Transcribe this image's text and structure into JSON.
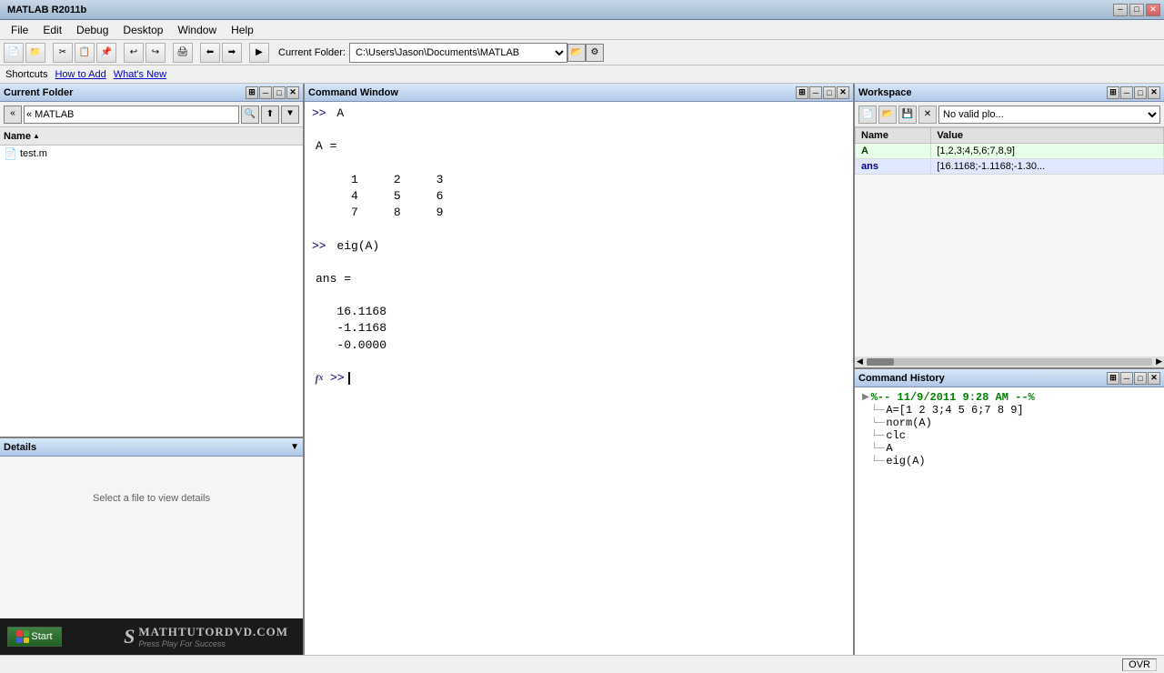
{
  "titlebar": {
    "title": "MATLAB R2011b",
    "min_label": "─",
    "max_label": "□",
    "close_label": "✕"
  },
  "menubar": {
    "items": [
      "File",
      "Edit",
      "Debug",
      "Desktop",
      "Window",
      "Help"
    ]
  },
  "toolbar": {
    "folder_label": "Current Folder:",
    "folder_path": "C:\\Users\\Jason\\Documents\\MATLAB"
  },
  "shortcuts": {
    "label": "Shortcuts",
    "how_to_add": "How to Add",
    "whats_new": "What's New"
  },
  "current_folder": {
    "title": "Current Folder",
    "path": "« MATLAB",
    "column_name": "Name",
    "sort_arrow": "▲",
    "files": [
      {
        "name": "test.m",
        "icon": "📄"
      }
    ]
  },
  "details": {
    "title": "Details",
    "expand": "▼",
    "message": "Select a file to view details"
  },
  "command_window": {
    "title": "Command Window",
    "lines": [
      {
        "type": "prompt",
        "text": ">> A"
      },
      {
        "type": "blank"
      },
      {
        "type": "output",
        "text": "A ="
      },
      {
        "type": "blank"
      },
      {
        "type": "matrix",
        "row1": "     1     2     3"
      },
      {
        "type": "matrix",
        "row2": "     4     5     6"
      },
      {
        "type": "matrix",
        "row3": "     7     8     9"
      },
      {
        "type": "blank"
      },
      {
        "type": "prompt",
        "text": ">> eig(A)"
      },
      {
        "type": "blank"
      },
      {
        "type": "output",
        "text": "ans ="
      },
      {
        "type": "blank"
      },
      {
        "type": "result",
        "val": "   16.1168"
      },
      {
        "type": "result",
        "val": "   -1.1168"
      },
      {
        "type": "result",
        "val": "   -0.0000"
      },
      {
        "type": "blank"
      }
    ],
    "current_prompt": ">>",
    "cursor_visible": true
  },
  "workspace": {
    "title": "Workspace",
    "plot_placeholder": "No valid plo...",
    "columns": [
      "Name",
      "Value"
    ],
    "rows": [
      {
        "type": "A",
        "name": "A",
        "value": "[1,2,3;4,5,6;7,8,9]"
      },
      {
        "type": "ans",
        "name": "ans",
        "value": "[16.1168;-1.1168;-1.30..."
      }
    ]
  },
  "history": {
    "title": "Command History",
    "session_label": "%-- 11/9/2011 9:28 AM --%",
    "commands": [
      "A=[1 2 3;4 5 6;7 8 9]",
      "norm(A)",
      "clc",
      "A",
      "eig(A)"
    ]
  },
  "statusbar": {
    "mode": "OVR"
  },
  "logo": {
    "s_letter": "S",
    "brand": "MathTutorDVD.com",
    "tagline": "Press Play For Success"
  },
  "start_btn": {
    "label": "Start"
  }
}
